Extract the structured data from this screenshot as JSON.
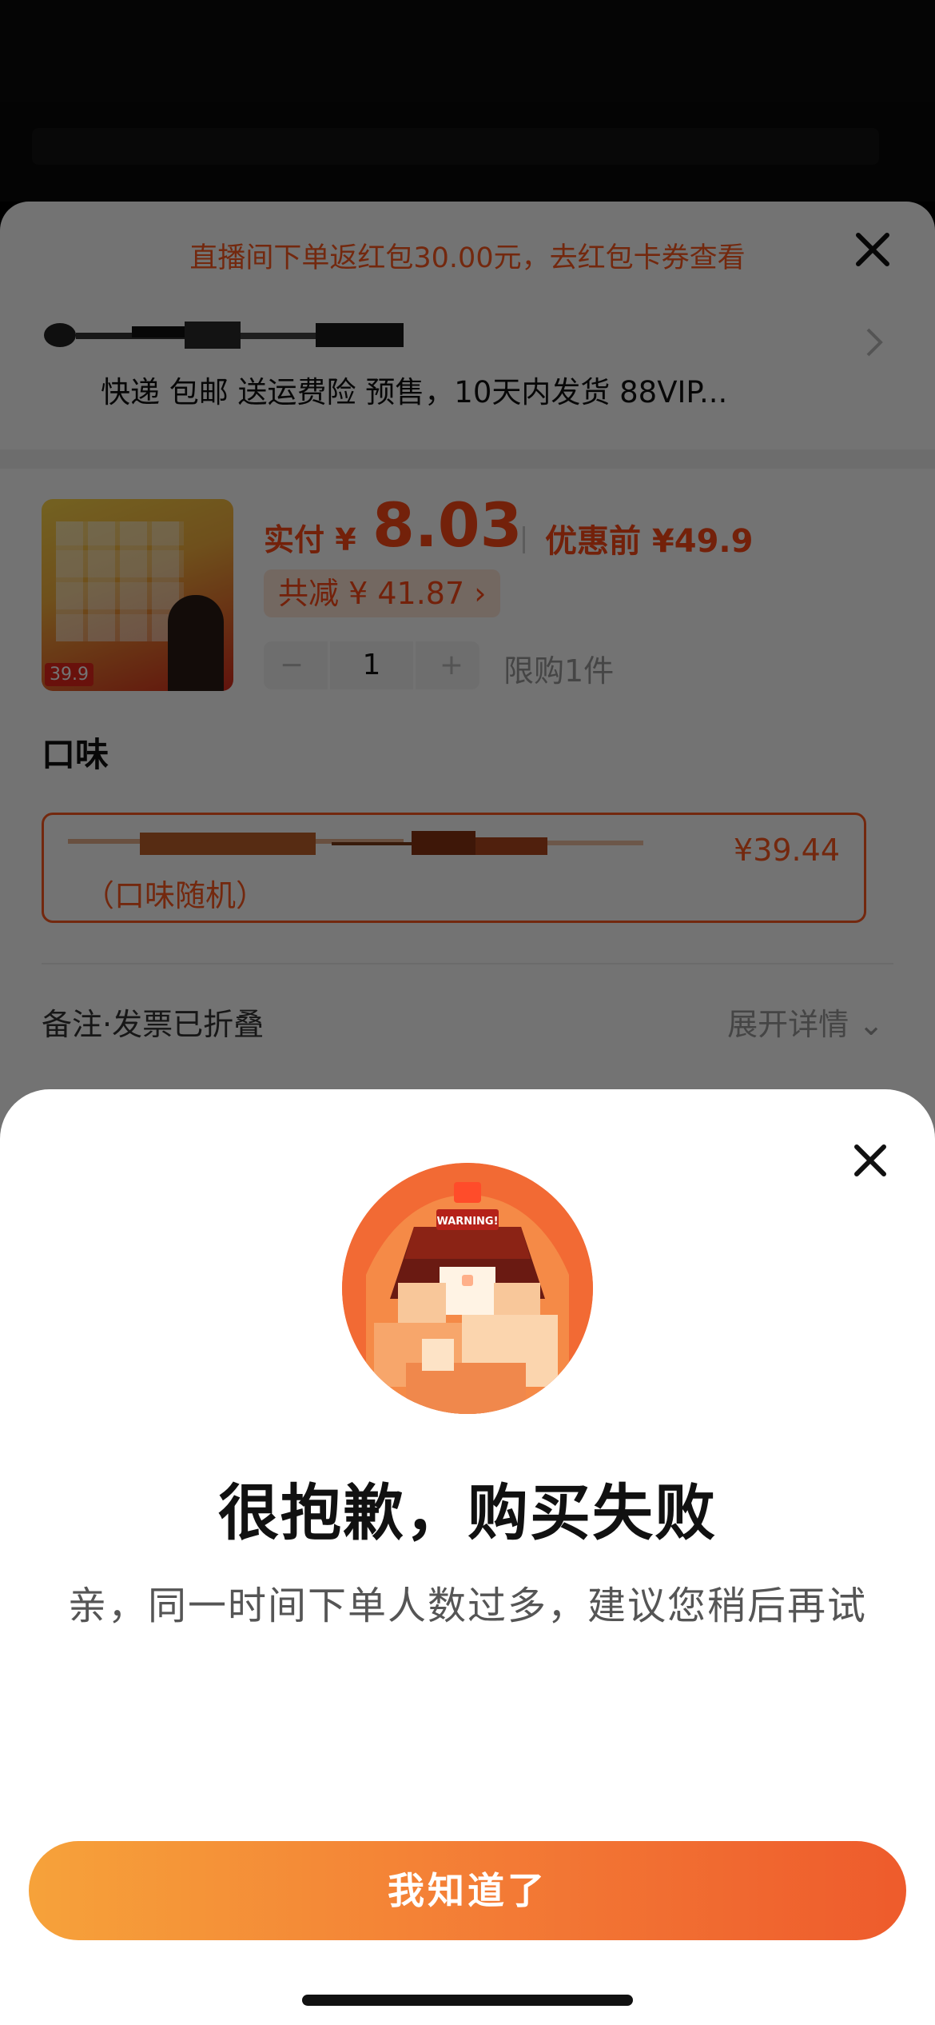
{
  "order": {
    "notice": "直播间下单返红包30.00元，去红包卡券查看",
    "address_detail": "快递 包邮 送运费险 预售，10天内发货 88VIP...",
    "product": {
      "image_price_tag": "39.9",
      "paid_label": "实付 ¥",
      "paid_value": "8.03",
      "pre_price": "优惠前 ¥49.9",
      "discount": "共减 ¥ 41.87 ›",
      "quantity": "1",
      "minus": "−",
      "plus": "+",
      "limit": "限购1件"
    },
    "flavor": {
      "title": "口味",
      "price": "¥39.44",
      "sub": "（口味随机）"
    },
    "notes": {
      "label": "备注·发票已折叠",
      "expand": "展开详情 ⌄"
    }
  },
  "modal": {
    "illustration_text": "WARNING!",
    "title": "很抱歉，购买失败",
    "message": "亲，同一时间下单人数过多，建议您稍后再试",
    "button_label": "我知道了"
  },
  "colors": {
    "accent": "#ff5a1f",
    "button_start": "#f6a23a",
    "button_end": "#ee5b2c"
  }
}
